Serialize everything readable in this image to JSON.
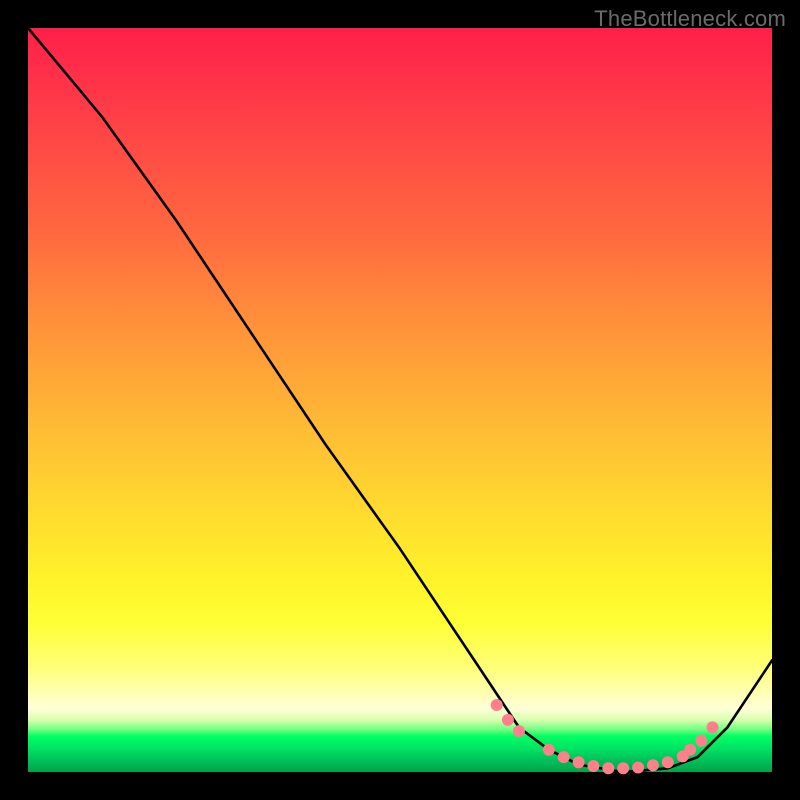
{
  "watermark": "TheBottleneck.com",
  "colors": {
    "frame_bg": "#000000",
    "watermark_text": "#6b6b6b",
    "curve_stroke": "#000000",
    "dot_fill": "#ff7f8a"
  },
  "chart_data": {
    "type": "line",
    "title": "",
    "xlabel": "",
    "ylabel": "",
    "xlim": [
      0,
      100
    ],
    "ylim": [
      0,
      100
    ],
    "note": "Axes are unlabeled; values are estimated from pixel positions as percentages of the plot area. y=100 is the top, y=0 is the bottom.",
    "series": [
      {
        "name": "curve",
        "x": [
          0,
          5,
          10,
          20,
          30,
          40,
          50,
          60,
          66,
          70,
          74,
          80,
          86,
          90,
          94,
          100
        ],
        "y": [
          100,
          94,
          88,
          74,
          59,
          44,
          30,
          15,
          6,
          3,
          1,
          0,
          0.5,
          2,
          6,
          15
        ]
      }
    ],
    "markers": {
      "name": "highlight-dots",
      "x": [
        63,
        64.5,
        66,
        70,
        72,
        74,
        76,
        78,
        80,
        82,
        84,
        86,
        88,
        89,
        90.5,
        92
      ],
      "y": [
        9,
        7,
        5.5,
        3,
        2,
        1.3,
        0.8,
        0.5,
        0.5,
        0.6,
        0.9,
        1.3,
        2.1,
        3.0,
        4.2,
        6
      ]
    },
    "background_gradient": {
      "direction": "vertical",
      "stops": [
        {
          "pos": 0,
          "color": "#ff1f4a"
        },
        {
          "pos": 40,
          "color": "#ff923a"
        },
        {
          "pos": 70,
          "color": "#ffe82c"
        },
        {
          "pos": 90,
          "color": "#ffffc0"
        },
        {
          "pos": 95,
          "color": "#00ff62"
        },
        {
          "pos": 100,
          "color": "#00a44a"
        }
      ]
    }
  }
}
